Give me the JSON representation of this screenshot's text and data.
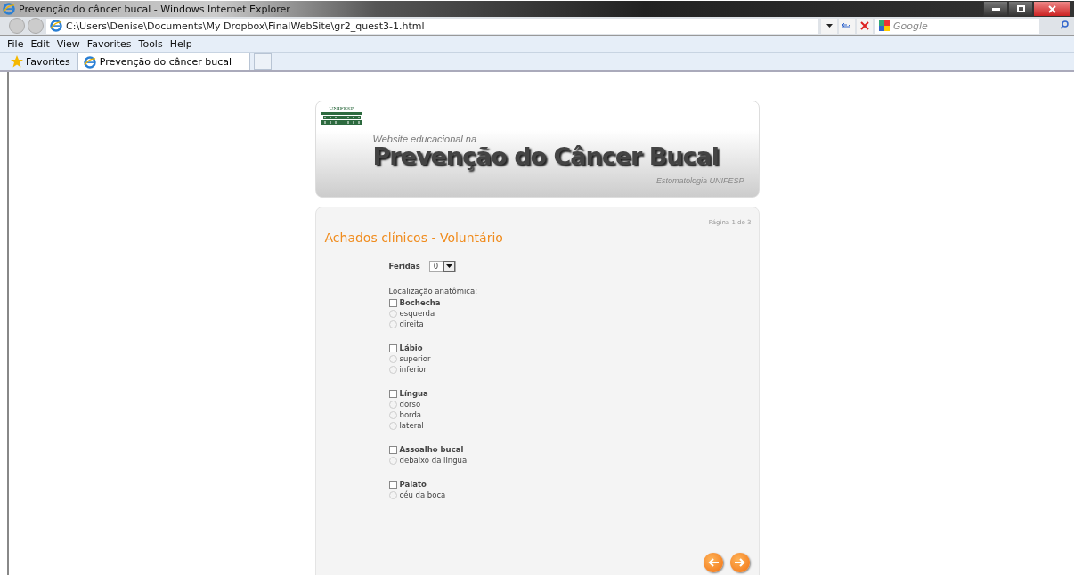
{
  "window": {
    "title": "Prevenção do câncer bucal - Windows Internet Explorer"
  },
  "address_bar": {
    "url": "C:\\Users\\Denise\\Documents\\My Dropbox\\FinalWebSite\\gr2_quest3-1.html",
    "search_placeholder": "Google"
  },
  "menu_bar": [
    "File",
    "Edit",
    "View",
    "Favorites",
    "Tools",
    "Help"
  ],
  "favorites_bar": {
    "favorites": "Favorites",
    "tabs": [
      {
        "label": "Prevenção do câncer bucal",
        "selected": true
      }
    ]
  },
  "header": {
    "logo": "UNIFESP",
    "subtitle": "Website educacional na",
    "title": "Prevenção do Câncer Bucal",
    "credit": "Estomatologia UNIFESP"
  },
  "form": {
    "page_indicator": "Página 1 de 3",
    "heading": "Achados clínicos - Voluntário",
    "wounds": {
      "label": "Feridas",
      "value": "0"
    },
    "location_label": "Localização anatômica:",
    "groups": [
      {
        "label": "Bochecha",
        "checked": false,
        "options": [
          {
            "label": "esquerda",
            "selected": false,
            "disabled": true
          },
          {
            "label": "direita",
            "selected": false,
            "disabled": true
          }
        ]
      },
      {
        "label": "Lábio",
        "checked": false,
        "options": [
          {
            "label": "superior",
            "selected": false,
            "disabled": true
          },
          {
            "label": "inferior",
            "selected": false,
            "disabled": true
          }
        ]
      },
      {
        "label": "Língua",
        "checked": false,
        "options": [
          {
            "label": "dorso",
            "selected": false,
            "disabled": true
          },
          {
            "label": "borda",
            "selected": false,
            "disabled": true
          },
          {
            "label": "lateral",
            "selected": false,
            "disabled": true
          }
        ]
      },
      {
        "label": "Assoalho bucal",
        "checked": false,
        "options": [
          {
            "label": "debaixo da lingua",
            "selected": false,
            "disabled": true
          }
        ]
      },
      {
        "label": "Palato",
        "checked": false,
        "options": [
          {
            "label": "céu da boca",
            "selected": false,
            "disabled": true
          }
        ]
      }
    ]
  }
}
